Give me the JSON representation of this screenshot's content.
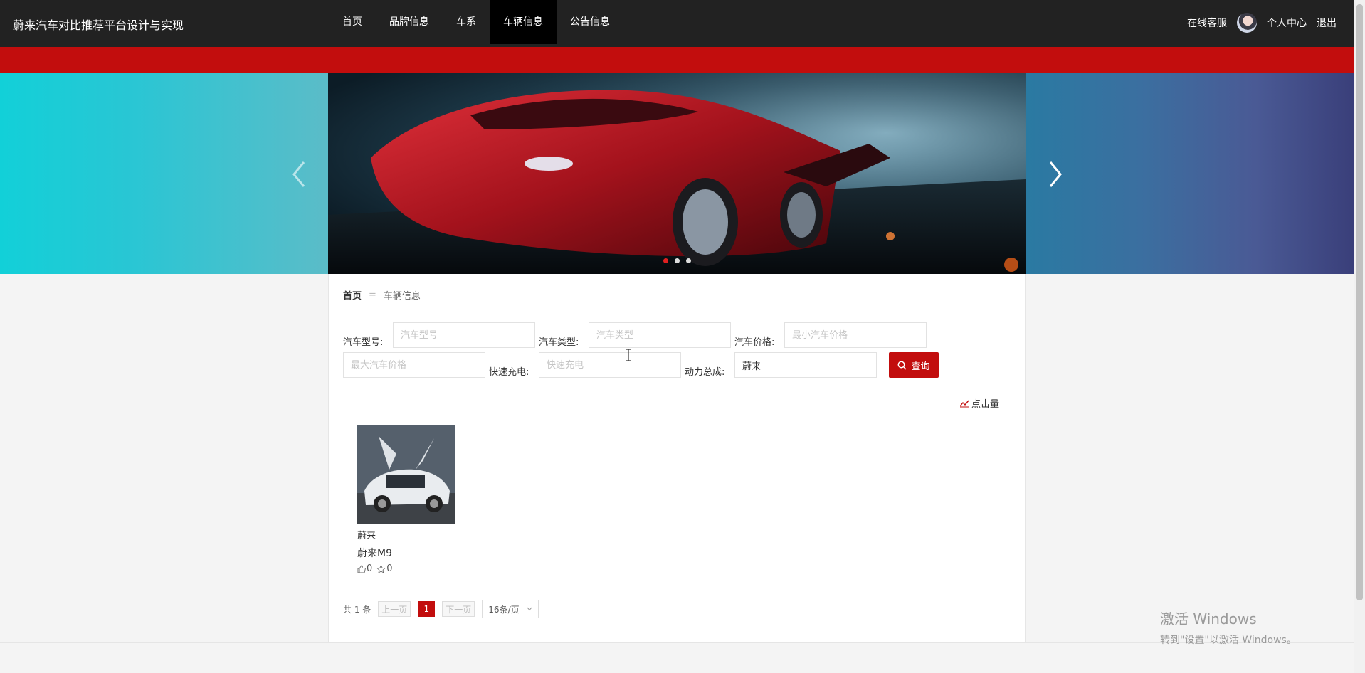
{
  "header": {
    "site_title": "蔚来汽车对比推荐平台设计与实现",
    "nav": [
      "首页",
      "品牌信息",
      "车系",
      "车辆信息",
      "公告信息"
    ],
    "active_nav": "车辆信息",
    "online_service": "在线客服",
    "personal_center": "个人中心",
    "logout": "退出"
  },
  "banner": {
    "slide_count": 3,
    "active_slide": 1
  },
  "breadcrumb": {
    "home": "首页",
    "separator": "=",
    "current": "车辆信息"
  },
  "search": {
    "model_label": "汽车型号:",
    "model_placeholder": "汽车型号",
    "type_label": "汽车类型:",
    "type_placeholder": "汽车类型",
    "price_label": "汽车价格:",
    "min_price_placeholder": "最小汽车价格",
    "max_price_placeholder": "最大汽车价格",
    "fast_charge_label": "快速充电:",
    "fast_charge_placeholder": "快速充电",
    "powertrain_label": "动力总成:",
    "powertrain_value": "蔚来",
    "button": "查询"
  },
  "sort": {
    "label": "点击量"
  },
  "cars": [
    {
      "brand": "蔚来",
      "name": "蔚来M9",
      "likes": "0",
      "favorites": "0"
    }
  ],
  "pagination": {
    "total": "共 1 条",
    "prev": "上一页",
    "current_page": "1",
    "next": "下一页",
    "page_size": "16条/页"
  },
  "watermark": {
    "line1": "激活 Windows",
    "line2": "转到\"设置\"以激活 Windows。"
  },
  "colors": {
    "accent_red": "#c20d0d",
    "topbar": "#222222"
  }
}
